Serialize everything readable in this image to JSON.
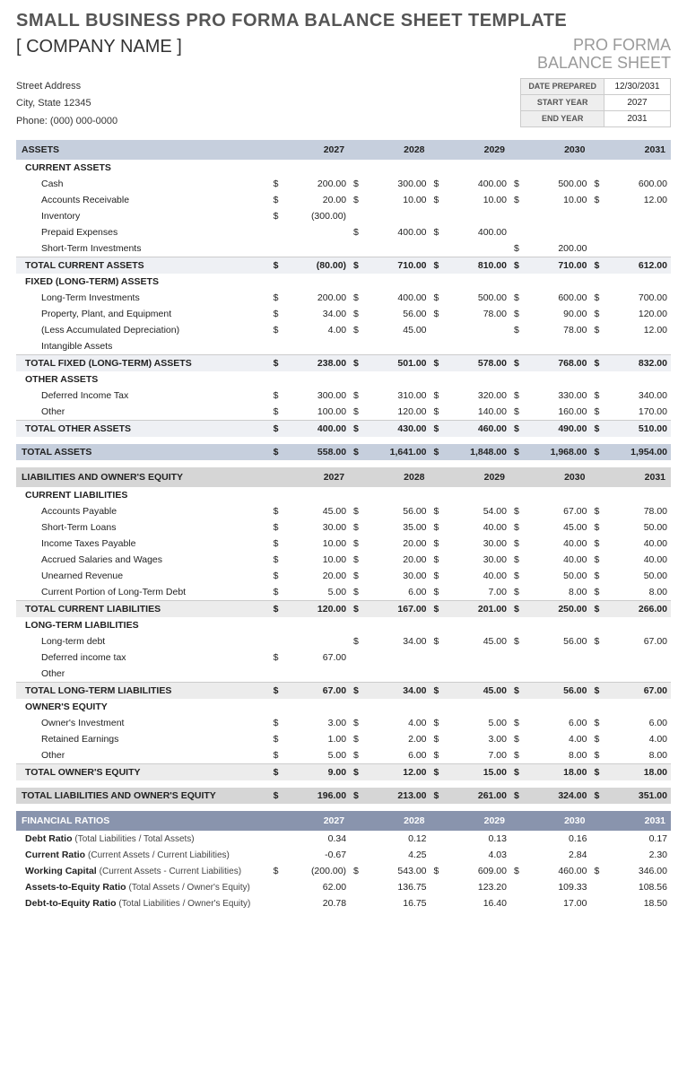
{
  "title": "SMALL BUSINESS PRO FORMA BALANCE SHEET TEMPLATE",
  "company": "[ COMPANY NAME ]",
  "proforma_line1": "PRO FORMA",
  "proforma_line2": "BALANCE SHEET",
  "address": {
    "street": "Street Address",
    "citystate": "City, State  12345",
    "phone": "Phone: (000) 000-0000"
  },
  "meta": {
    "date_prepared_lbl": "DATE PREPARED",
    "date_prepared": "12/30/2031",
    "start_year_lbl": "START YEAR",
    "start_year": "2027",
    "end_year_lbl": "END YEAR",
    "end_year": "2031"
  },
  "years": [
    "2027",
    "2028",
    "2029",
    "2030",
    "2031"
  ],
  "headers": {
    "assets": "ASSETS",
    "liab": "LIABILITIES AND OWNER'S EQUITY",
    "ratios": "FINANCIAL RATIOS"
  },
  "assets": {
    "current_label": "CURRENT ASSETS",
    "current": [
      {
        "label": "Cash",
        "v": [
          "200.00",
          "300.00",
          "400.00",
          "500.00",
          "600.00"
        ]
      },
      {
        "label": "Accounts Receivable",
        "v": [
          "20.00",
          "10.00",
          "10.00",
          "10.00",
          "12.00"
        ]
      },
      {
        "label": "Inventory",
        "v": [
          "(300.00)",
          "",
          "",
          "",
          ""
        ]
      },
      {
        "label": "Prepaid Expenses",
        "v": [
          "",
          "400.00",
          "400.00",
          "",
          ""
        ]
      },
      {
        "label": "Short-Term Investments",
        "v": [
          "",
          "",
          "",
          "200.00",
          ""
        ]
      }
    ],
    "current_total": {
      "label": "TOTAL CURRENT ASSETS",
      "v": [
        "(80.00)",
        "710.00",
        "810.00",
        "710.00",
        "612.00"
      ]
    },
    "fixed_label": "FIXED (LONG-TERM) ASSETS",
    "fixed": [
      {
        "label": "Long-Term Investments",
        "v": [
          "200.00",
          "400.00",
          "500.00",
          "600.00",
          "700.00"
        ]
      },
      {
        "label": "Property, Plant, and Equipment",
        "v": [
          "34.00",
          "56.00",
          "78.00",
          "90.00",
          "120.00"
        ]
      },
      {
        "label": "(Less Accumulated Depreciation)",
        "v": [
          "4.00",
          "45.00",
          "",
          "78.00",
          "12.00"
        ]
      },
      {
        "label": "Intangible Assets",
        "v": [
          "",
          "",
          "",
          "",
          ""
        ]
      }
    ],
    "fixed_total": {
      "label": "TOTAL FIXED (LONG-TERM) ASSETS",
      "v": [
        "238.00",
        "501.00",
        "578.00",
        "768.00",
        "832.00"
      ]
    },
    "other_label": "OTHER ASSETS",
    "other": [
      {
        "label": "Deferred Income Tax",
        "v": [
          "300.00",
          "310.00",
          "320.00",
          "330.00",
          "340.00"
        ]
      },
      {
        "label": "Other",
        "v": [
          "100.00",
          "120.00",
          "140.00",
          "160.00",
          "170.00"
        ]
      }
    ],
    "other_total": {
      "label": "TOTAL OTHER ASSETS",
      "v": [
        "400.00",
        "430.00",
        "460.00",
        "490.00",
        "510.00"
      ]
    },
    "grand": {
      "label": "TOTAL ASSETS",
      "v": [
        "558.00",
        "1,641.00",
        "1,848.00",
        "1,968.00",
        "1,954.00"
      ]
    }
  },
  "liab": {
    "current_label": "CURRENT LIABILITIES",
    "current": [
      {
        "label": "Accounts Payable",
        "v": [
          "45.00",
          "56.00",
          "54.00",
          "67.00",
          "78.00"
        ]
      },
      {
        "label": "Short-Term Loans",
        "v": [
          "30.00",
          "35.00",
          "40.00",
          "45.00",
          "50.00"
        ]
      },
      {
        "label": "Income Taxes Payable",
        "v": [
          "10.00",
          "20.00",
          "30.00",
          "40.00",
          "40.00"
        ]
      },
      {
        "label": "Accrued Salaries and Wages",
        "v": [
          "10.00",
          "20.00",
          "30.00",
          "40.00",
          "40.00"
        ]
      },
      {
        "label": "Unearned Revenue",
        "v": [
          "20.00",
          "30.00",
          "40.00",
          "50.00",
          "50.00"
        ]
      },
      {
        "label": "Current Portion of Long-Term Debt",
        "v": [
          "5.00",
          "6.00",
          "7.00",
          "8.00",
          "8.00"
        ]
      }
    ],
    "current_total": {
      "label": "TOTAL CURRENT LIABILITIES",
      "v": [
        "120.00",
        "167.00",
        "201.00",
        "250.00",
        "266.00"
      ]
    },
    "long_label": "LONG-TERM LIABILITIES",
    "long": [
      {
        "label": "Long-term debt",
        "v": [
          "",
          "34.00",
          "45.00",
          "56.00",
          "67.00"
        ]
      },
      {
        "label": "Deferred income tax",
        "v": [
          "67.00",
          "",
          "",
          "",
          ""
        ]
      },
      {
        "label": "Other",
        "v": [
          "",
          "",
          "",
          "",
          ""
        ]
      }
    ],
    "long_total": {
      "label": "TOTAL LONG-TERM LIABILITIES",
      "v": [
        "67.00",
        "34.00",
        "45.00",
        "56.00",
        "67.00"
      ]
    },
    "equity_label": "OWNER'S EQUITY",
    "equity": [
      {
        "label": "Owner's Investment",
        "v": [
          "3.00",
          "4.00",
          "5.00",
          "6.00",
          "6.00"
        ]
      },
      {
        "label": "Retained Earnings",
        "v": [
          "1.00",
          "2.00",
          "3.00",
          "4.00",
          "4.00"
        ]
      },
      {
        "label": "Other",
        "v": [
          "5.00",
          "6.00",
          "7.00",
          "8.00",
          "8.00"
        ]
      }
    ],
    "equity_total": {
      "label": "TOTAL OWNER'S EQUITY",
      "v": [
        "9.00",
        "12.00",
        "15.00",
        "18.00",
        "18.00"
      ]
    },
    "grand": {
      "label": "TOTAL LIABILITIES AND OWNER'S EQUITY",
      "v": [
        "196.00",
        "213.00",
        "261.00",
        "324.00",
        "351.00"
      ]
    }
  },
  "ratios": [
    {
      "label": "Debt Ratio",
      "sub": "(Total Liabilities / Total Assets)",
      "sym": false,
      "v": [
        "0.34",
        "0.12",
        "0.13",
        "0.16",
        "0.17"
      ]
    },
    {
      "label": "Current Ratio",
      "sub": "(Current Assets / Current Liabilities)",
      "sym": false,
      "v": [
        "-0.67",
        "4.25",
        "4.03",
        "2.84",
        "2.30"
      ]
    },
    {
      "label": "Working Capital",
      "sub": "(Current Assets - Current Liabilities)",
      "sym": true,
      "v": [
        "(200.00)",
        "543.00",
        "609.00",
        "460.00",
        "346.00"
      ]
    },
    {
      "label": "Assets-to-Equity Ratio",
      "sub": "(Total Assets / Owner's Equity)",
      "sym": false,
      "v": [
        "62.00",
        "136.75",
        "123.20",
        "109.33",
        "108.56"
      ]
    },
    {
      "label": "Debt-to-Equity Ratio",
      "sub": "(Total Liabilities / Owner's Equity)",
      "sym": false,
      "v": [
        "20.78",
        "16.75",
        "16.40",
        "17.00",
        "18.50"
      ]
    }
  ]
}
